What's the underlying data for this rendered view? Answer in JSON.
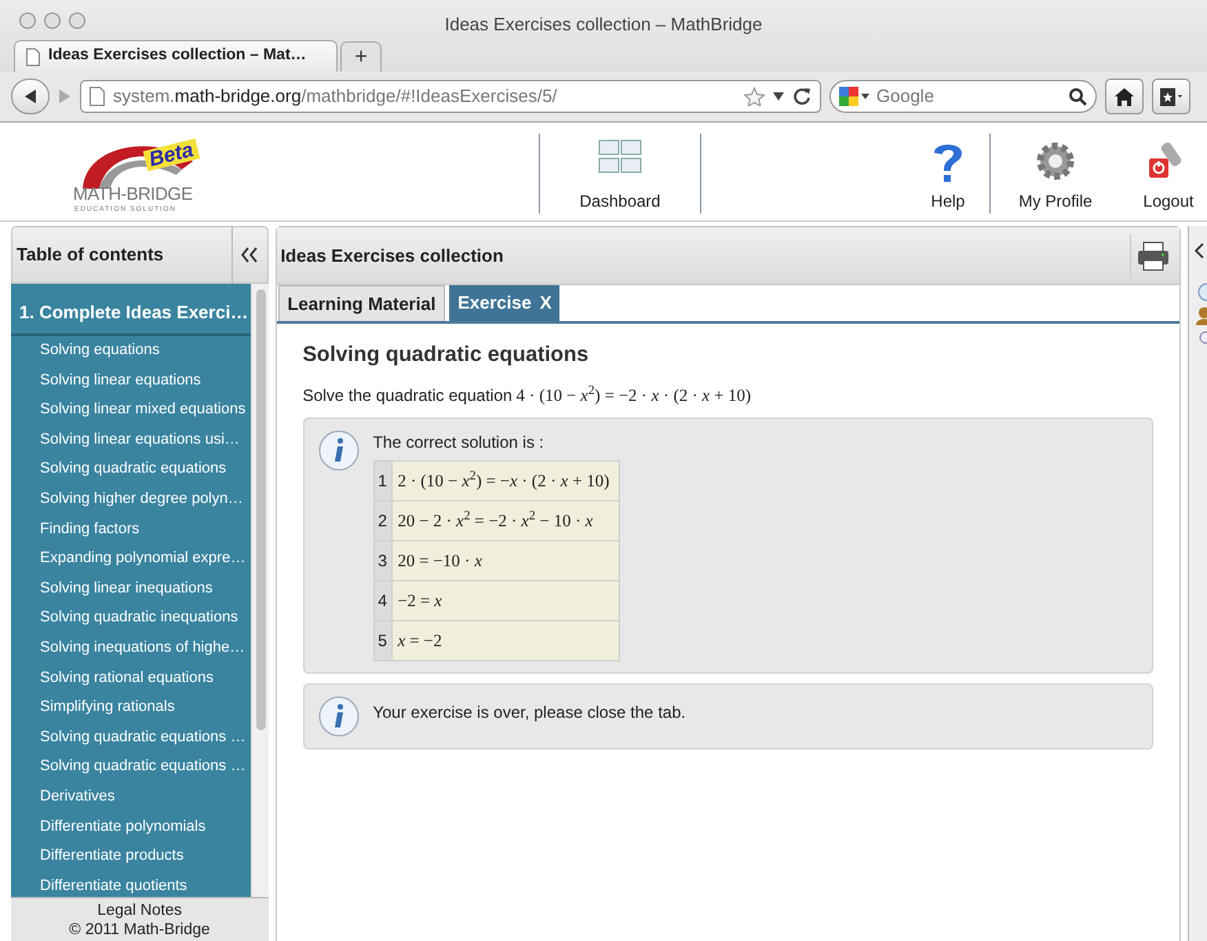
{
  "window": {
    "title": "Ideas Exercises collection – MathBridge"
  },
  "browser_tab": {
    "title": "Ideas Exercises collection – Mat…",
    "new_tab": "+"
  },
  "address": {
    "url": "system.**math-bridge.org**/mathbridge/#!IdeasExercises/5/"
  },
  "search": {
    "placeholder": "Google"
  },
  "logo": {
    "name": "MATH-BRIDGE",
    "tagline": "EDUCATION SOLUTION",
    "badge": "Beta"
  },
  "header_nav": [
    {
      "label": "Dashboard",
      "kind": "dashboard"
    },
    {
      "label": "Help",
      "kind": "help"
    },
    {
      "label": "My Profile",
      "kind": "profile"
    },
    {
      "label": "Logout",
      "kind": "logout"
    }
  ],
  "toc": {
    "title": "Table of contents",
    "chapter": "1. Complete Ideas Exerci…",
    "items": [
      "Solving equations",
      "Solving linear equations",
      "Solving linear mixed equations",
      "Solving linear equations usi…",
      "Solving quadratic equations",
      "Solving higher degree polyn…",
      "Finding factors",
      "Expanding polynomial expre…",
      "Solving linear inequations",
      "Solving quadratic inequations",
      "Solving inequations of highe…",
      "Solving rational equations",
      "Simplifying rationals",
      "Solving quadratic equations …",
      "Solving quadratic equations …",
      "Derivatives",
      "Differentiate polynomials",
      "Differentiate products",
      "Differentiate quotients"
    ],
    "footer": [
      "Legal Notes",
      "© 2011 Math-Bridge"
    ]
  },
  "main": {
    "title": "Ideas Exercises collection",
    "tabs": [
      {
        "label": "Learning Material",
        "selected": false
      },
      {
        "label": "Exercise",
        "selected": true,
        "close": "X"
      }
    ],
    "heading": "Solving quadratic equations",
    "question": "Solve the quadratic equation",
    "question_math": "4 · (10 − *x*$^{2}$) = −2 · *x* · (2 · *x* + 10)",
    "solution": {
      "title": "The correct solution is :",
      "steps": [
        {
          "number": "1",
          "expr": "2 · (10 − *x*$^{2}$) = −*x* · (2 · *x* + 10)"
        },
        {
          "number": "2",
          "expr": "20 − 2 · *x*$^{2}$ = −2 · *x*$^{2}$ − 10 · *x*"
        },
        {
          "number": "3",
          "expr": "20 = −10 · *x*"
        },
        {
          "number": "4",
          "expr": "−2 = *x*"
        },
        {
          "number": "5",
          "expr": "*x* = −2"
        }
      ]
    },
    "notice": "Your exercise is over, please close the tab."
  }
}
